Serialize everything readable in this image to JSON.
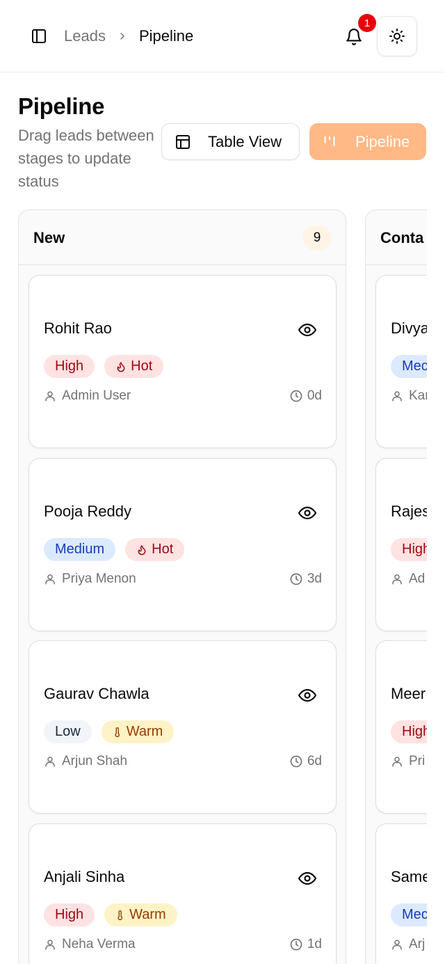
{
  "header": {
    "breadcrumb": {
      "parent": "Leads",
      "current": "Pipeline"
    },
    "notification_count": "1"
  },
  "page": {
    "title": "Pipeline",
    "subtitle": "Drag leads between stages to update status",
    "views": {
      "table_label": "Table View",
      "pipeline_label": "Pipeline",
      "active": "Pipeline"
    }
  },
  "colors": {
    "accent": "#ffb986",
    "badge_red": "#e7000b",
    "priority_high_bg": "#ffe2e2",
    "priority_medium_bg": "#dbeafe",
    "priority_low_bg": "#f1f5f9",
    "temp_warm_bg": "#fef3c6"
  },
  "columns": [
    {
      "title": "New",
      "count": "9",
      "cards": [
        {
          "name": "Rohit Rao",
          "priority": "High",
          "temperature": "Hot",
          "owner": "Admin User",
          "age": "0d"
        },
        {
          "name": "Pooja Reddy",
          "priority": "Medium",
          "temperature": "Hot",
          "owner": "Priya Menon",
          "age": "3d"
        },
        {
          "name": "Gaurav Chawla",
          "priority": "Low",
          "temperature": "Warm",
          "owner": "Arjun Shah",
          "age": "6d"
        },
        {
          "name": "Anjali Sinha",
          "priority": "High",
          "temperature": "Warm",
          "owner": "Neha Verma",
          "age": "1d"
        }
      ]
    },
    {
      "title": "Conta",
      "cards": [
        {
          "name": "Divya",
          "priority": "Mec",
          "owner": "Kar"
        },
        {
          "name": "Rajes",
          "priority": "High",
          "owner": "Ad"
        },
        {
          "name": "Meer",
          "priority": "High",
          "owner": "Pri"
        },
        {
          "name": "Same",
          "priority": "Mec",
          "owner": "Arj"
        }
      ]
    }
  ]
}
